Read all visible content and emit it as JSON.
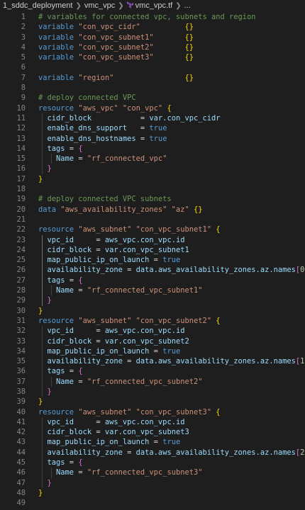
{
  "breadcrumb": {
    "folder1": "1_sddc_deployment",
    "folder2": "vmc_vpc",
    "file": "vmc_vpc.tf",
    "more": "..."
  },
  "lines": [
    {
      "n": 1,
      "tokens": [
        [
          "t-com",
          "# variables for connected vpc, subnets and region"
        ]
      ]
    },
    {
      "n": 2,
      "tokens": [
        [
          "t-kw",
          "variable "
        ],
        [
          "t-str",
          "\"con_vpc_cidr\""
        ],
        [
          "t-plain",
          "          "
        ],
        [
          "t-br",
          "{}"
        ]
      ]
    },
    {
      "n": 3,
      "tokens": [
        [
          "t-kw",
          "variable "
        ],
        [
          "t-str",
          "\"con_vpc_subnet1\""
        ],
        [
          "t-plain",
          "       "
        ],
        [
          "t-br",
          "{}"
        ]
      ]
    },
    {
      "n": 4,
      "tokens": [
        [
          "t-kw",
          "variable "
        ],
        [
          "t-str",
          "\"con_vpc_subnet2\""
        ],
        [
          "t-plain",
          "       "
        ],
        [
          "t-br",
          "{}"
        ]
      ]
    },
    {
      "n": 5,
      "tokens": [
        [
          "t-kw",
          "variable "
        ],
        [
          "t-str",
          "\"con_vpc_subnet3\""
        ],
        [
          "t-plain",
          "       "
        ],
        [
          "t-br",
          "{}"
        ]
      ]
    },
    {
      "n": 6,
      "tokens": []
    },
    {
      "n": 7,
      "tokens": [
        [
          "t-kw",
          "variable "
        ],
        [
          "t-str",
          "\"region\""
        ],
        [
          "t-plain",
          "                "
        ],
        [
          "t-br",
          "{}"
        ]
      ]
    },
    {
      "n": 8,
      "tokens": []
    },
    {
      "n": 9,
      "tokens": [
        [
          "t-com",
          "# deploy connected VPC"
        ]
      ]
    },
    {
      "n": 10,
      "tokens": [
        [
          "t-kw",
          "resource "
        ],
        [
          "t-str",
          "\"aws_vpc\" \"con_vpc\" "
        ],
        [
          "t-br",
          "{"
        ]
      ]
    },
    {
      "n": 11,
      "tokens": [
        [
          "t-plain",
          "  "
        ],
        [
          "t-id",
          "cidr_block"
        ],
        [
          "t-plain",
          "           "
        ],
        [
          "t-op",
          "= "
        ],
        [
          "t-id",
          "var.con_vpc_cidr"
        ]
      ]
    },
    {
      "n": 12,
      "tokens": [
        [
          "t-plain",
          "  "
        ],
        [
          "t-id",
          "enable_dns_support"
        ],
        [
          "t-plain",
          "   "
        ],
        [
          "t-op",
          "= "
        ],
        [
          "t-kw",
          "true"
        ]
      ]
    },
    {
      "n": 13,
      "tokens": [
        [
          "t-plain",
          "  "
        ],
        [
          "t-id",
          "enable_dns_hostnames"
        ],
        [
          "t-plain",
          " "
        ],
        [
          "t-op",
          "= "
        ],
        [
          "t-kw",
          "true"
        ]
      ]
    },
    {
      "n": 14,
      "tokens": [
        [
          "t-plain",
          "  "
        ],
        [
          "t-id",
          "tags"
        ],
        [
          "t-op",
          " = "
        ],
        [
          "t-br2",
          "{"
        ]
      ]
    },
    {
      "n": 15,
      "tokens": [
        [
          "t-plain",
          "    "
        ],
        [
          "t-id",
          "Name"
        ],
        [
          "t-op",
          " = "
        ],
        [
          "t-str",
          "\"rf_connected_vpc\""
        ]
      ]
    },
    {
      "n": 16,
      "tokens": [
        [
          "t-plain",
          "  "
        ],
        [
          "t-br2",
          "}"
        ]
      ]
    },
    {
      "n": 17,
      "tokens": [
        [
          "t-br",
          "}"
        ]
      ]
    },
    {
      "n": 18,
      "tokens": []
    },
    {
      "n": 19,
      "tokens": [
        [
          "t-com",
          "# deploy connected VPC subnets"
        ]
      ]
    },
    {
      "n": 20,
      "tokens": [
        [
          "t-kw",
          "data "
        ],
        [
          "t-str",
          "\"aws_availability_zones\" \"az\" "
        ],
        [
          "t-br",
          "{}"
        ]
      ]
    },
    {
      "n": 21,
      "tokens": []
    },
    {
      "n": 22,
      "tokens": [
        [
          "t-kw",
          "resource "
        ],
        [
          "t-str",
          "\"aws_subnet\" \"con_vpc_subnet1\" "
        ],
        [
          "t-br",
          "{"
        ]
      ]
    },
    {
      "n": 23,
      "tokens": [
        [
          "t-plain",
          "  "
        ],
        [
          "t-id",
          "vpc_id"
        ],
        [
          "t-plain",
          "     "
        ],
        [
          "t-op",
          "= "
        ],
        [
          "t-id",
          "aws_vpc.con_vpc.id"
        ]
      ]
    },
    {
      "n": 24,
      "tokens": [
        [
          "t-plain",
          "  "
        ],
        [
          "t-id",
          "cidr_block"
        ],
        [
          "t-op",
          " = "
        ],
        [
          "t-id",
          "var.con_vpc_subnet1"
        ]
      ]
    },
    {
      "n": 25,
      "tokens": [
        [
          "t-plain",
          "  "
        ],
        [
          "t-id",
          "map_public_ip_on_launch"
        ],
        [
          "t-op",
          " = "
        ],
        [
          "t-kw",
          "true"
        ]
      ]
    },
    {
      "n": 26,
      "tokens": [
        [
          "t-plain",
          "  "
        ],
        [
          "t-id",
          "availability_zone"
        ],
        [
          "t-op",
          " = "
        ],
        [
          "t-id",
          "data.aws_availability_zones.az.names"
        ],
        [
          "t-br2",
          "["
        ],
        [
          "t-num",
          "0"
        ],
        [
          "t-br2",
          "]"
        ]
      ]
    },
    {
      "n": 27,
      "tokens": [
        [
          "t-plain",
          "  "
        ],
        [
          "t-id",
          "tags"
        ],
        [
          "t-op",
          " = "
        ],
        [
          "t-br2",
          "{"
        ]
      ]
    },
    {
      "n": 28,
      "tokens": [
        [
          "t-plain",
          "    "
        ],
        [
          "t-id",
          "Name"
        ],
        [
          "t-op",
          " = "
        ],
        [
          "t-str",
          "\"rf_connected_vpc_subnet1\""
        ]
      ]
    },
    {
      "n": 29,
      "tokens": [
        [
          "t-plain",
          "  "
        ],
        [
          "t-br2",
          "}"
        ]
      ]
    },
    {
      "n": 30,
      "tokens": [
        [
          "t-br",
          "}"
        ]
      ]
    },
    {
      "n": 31,
      "tokens": [
        [
          "t-kw",
          "resource "
        ],
        [
          "t-str",
          "\"aws_subnet\" \"con_vpc_subnet2\" "
        ],
        [
          "t-br",
          "{"
        ]
      ]
    },
    {
      "n": 32,
      "tokens": [
        [
          "t-plain",
          "  "
        ],
        [
          "t-id",
          "vpc_id"
        ],
        [
          "t-plain",
          "     "
        ],
        [
          "t-op",
          "= "
        ],
        [
          "t-id",
          "aws_vpc.con_vpc.id"
        ]
      ]
    },
    {
      "n": 33,
      "tokens": [
        [
          "t-plain",
          "  "
        ],
        [
          "t-id",
          "cidr_block"
        ],
        [
          "t-op",
          " = "
        ],
        [
          "t-id",
          "var.con_vpc_subnet2"
        ]
      ]
    },
    {
      "n": 34,
      "tokens": [
        [
          "t-plain",
          "  "
        ],
        [
          "t-id",
          "map_public_ip_on_launch"
        ],
        [
          "t-op",
          " = "
        ],
        [
          "t-kw",
          "true"
        ]
      ]
    },
    {
      "n": 35,
      "tokens": [
        [
          "t-plain",
          "  "
        ],
        [
          "t-id",
          "availability_zone"
        ],
        [
          "t-op",
          " = "
        ],
        [
          "t-id",
          "data.aws_availability_zones.az.names"
        ],
        [
          "t-br2",
          "["
        ],
        [
          "t-num",
          "1"
        ],
        [
          "t-br2",
          "]"
        ]
      ]
    },
    {
      "n": 36,
      "tokens": [
        [
          "t-plain",
          "  "
        ],
        [
          "t-id",
          "tags"
        ],
        [
          "t-op",
          " = "
        ],
        [
          "t-br2",
          "{"
        ]
      ]
    },
    {
      "n": 37,
      "tokens": [
        [
          "t-plain",
          "    "
        ],
        [
          "t-id",
          "Name"
        ],
        [
          "t-op",
          " = "
        ],
        [
          "t-str",
          "\"rf_connected_vpc_subnet2\""
        ]
      ]
    },
    {
      "n": 38,
      "tokens": [
        [
          "t-plain",
          "  "
        ],
        [
          "t-br2",
          "}"
        ]
      ]
    },
    {
      "n": 39,
      "tokens": [
        [
          "t-br",
          "}"
        ]
      ]
    },
    {
      "n": 40,
      "tokens": [
        [
          "t-kw",
          "resource "
        ],
        [
          "t-str",
          "\"aws_subnet\" \"con_vpc_subnet3\" "
        ],
        [
          "t-br",
          "{"
        ]
      ]
    },
    {
      "n": 41,
      "tokens": [
        [
          "t-plain",
          "  "
        ],
        [
          "t-id",
          "vpc_id"
        ],
        [
          "t-plain",
          "     "
        ],
        [
          "t-op",
          "= "
        ],
        [
          "t-id",
          "aws_vpc.con_vpc.id"
        ]
      ]
    },
    {
      "n": 42,
      "tokens": [
        [
          "t-plain",
          "  "
        ],
        [
          "t-id",
          "cidr_block"
        ],
        [
          "t-op",
          " = "
        ],
        [
          "t-id",
          "var.con_vpc_subnet3"
        ]
      ]
    },
    {
      "n": 43,
      "tokens": [
        [
          "t-plain",
          "  "
        ],
        [
          "t-id",
          "map_public_ip_on_launch"
        ],
        [
          "t-op",
          " = "
        ],
        [
          "t-kw",
          "true"
        ]
      ]
    },
    {
      "n": 44,
      "tokens": [
        [
          "t-plain",
          "  "
        ],
        [
          "t-id",
          "availability_zone"
        ],
        [
          "t-op",
          " = "
        ],
        [
          "t-id",
          "data.aws_availability_zones.az.names"
        ],
        [
          "t-br2",
          "["
        ],
        [
          "t-num",
          "2"
        ],
        [
          "t-br2",
          "]"
        ]
      ]
    },
    {
      "n": 45,
      "tokens": [
        [
          "t-plain",
          "  "
        ],
        [
          "t-id",
          "tags"
        ],
        [
          "t-op",
          " = "
        ],
        [
          "t-br2",
          "{"
        ]
      ]
    },
    {
      "n": 46,
      "tokens": [
        [
          "t-plain",
          "    "
        ],
        [
          "t-id",
          "Name"
        ],
        [
          "t-op",
          " = "
        ],
        [
          "t-str",
          "\"rf_connected_vpc_subnet3\""
        ]
      ]
    },
    {
      "n": 47,
      "tokens": [
        [
          "t-plain",
          "  "
        ],
        [
          "t-br2",
          "}"
        ]
      ]
    },
    {
      "n": 48,
      "tokens": [
        [
          "t-br",
          "}"
        ]
      ]
    },
    {
      "n": 49,
      "tokens": []
    }
  ]
}
